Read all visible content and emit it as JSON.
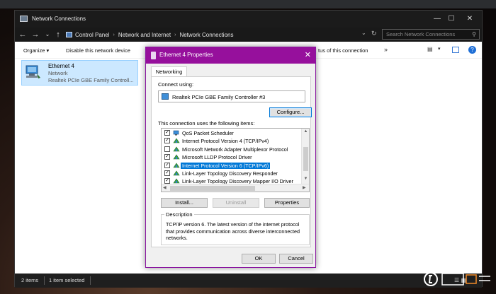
{
  "window": {
    "title": "Network Connections",
    "controls": {
      "minimize": "—",
      "maximize": "☐",
      "close": "✕"
    }
  },
  "address_bar": {
    "back": "←",
    "forward": "→",
    "recent": "⌄",
    "up": "↑",
    "breadcrumb": [
      "Control Panel",
      "Network and Internet",
      "Network Connections"
    ],
    "separator": "›",
    "dropdown": "⌄",
    "refresh": "↻",
    "search_placeholder": "Search Network Connections",
    "search_icon": "⚲"
  },
  "command_bar": {
    "organize": "Organize ▾",
    "disable": "Disable this network device",
    "status": "tus of this connection",
    "more": "»",
    "view_dropdown": "▾",
    "help_icon": "?"
  },
  "adapter": {
    "name": "Ethernet 4",
    "network": "Network",
    "device": "Realtek PCIe GBE Family Controll..."
  },
  "status_bar": {
    "count": "2 items",
    "selected": "1 item selected",
    "icons": "☰ ▦"
  },
  "dialog": {
    "title": "Ethernet 4 Properties",
    "close": "✕",
    "tab": "Networking",
    "connect_using_label": "Connect using:",
    "adapter_name": "Realtek PCIe GBE Family Controller #3",
    "configure_button": "Configure...",
    "items_label": "This connection uses the following items:",
    "items": [
      {
        "label": "QoS Packet Scheduler",
        "checked": true,
        "icon": "scheduler-icon"
      },
      {
        "label": "Internet Protocol Version 4 (TCP/IPv4)",
        "checked": true,
        "icon": "protocol-icon"
      },
      {
        "label": "Microsoft Network Adapter Multiplexor Protocol",
        "checked": false,
        "icon": "protocol-icon"
      },
      {
        "label": "Microsoft LLDP Protocol Driver",
        "checked": true,
        "icon": "protocol-icon"
      },
      {
        "label": "Internet Protocol Version 6 (TCP/IPv6)",
        "checked": true,
        "icon": "protocol-icon",
        "selected": true
      },
      {
        "label": "Link-Layer Topology Discovery Responder",
        "checked": true,
        "icon": "protocol-icon"
      },
      {
        "label": "Link-Layer Topology Discovery Mapper I/O Driver",
        "checked": true,
        "icon": "protocol-icon"
      }
    ],
    "check_mark": "✓",
    "scroll_up": "▲",
    "scroll_down": "▼",
    "scroll_left": "◀",
    "scroll_right": "▶",
    "install_button": "Install...",
    "uninstall_button": "Uninstall",
    "properties_button": "Properties",
    "description_legend": "Description",
    "description_text": "TCP/IP version 6. The latest version of the internet protocol that provides communication across diverse interconnected networks.",
    "ok_button": "OK",
    "cancel_button": "Cancel"
  },
  "colors": {
    "dialog_title_bar": "#96109c",
    "selection": "#0078d7",
    "explorer_chrome": "#1b1b1b"
  }
}
